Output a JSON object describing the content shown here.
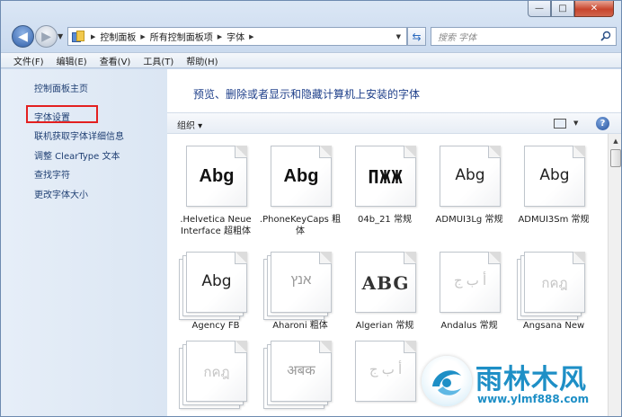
{
  "window": {
    "caption_min": "—",
    "caption_max": "□",
    "caption_close": "✕"
  },
  "address": {
    "crumbs": [
      "控制面板",
      "所有控制面板项",
      "字体"
    ],
    "search_placeholder": "搜索 字体"
  },
  "menu": [
    "文件(F)",
    "编辑(E)",
    "查看(V)",
    "工具(T)",
    "帮助(H)"
  ],
  "sidebar": {
    "items": [
      {
        "label": "控制面板主页"
      },
      {
        "label": "字体设置"
      },
      {
        "label": "联机获取字体详细信息"
      },
      {
        "label": "调整 ClearType 文本"
      },
      {
        "label": "查找字符"
      },
      {
        "label": "更改字体大小"
      }
    ]
  },
  "main": {
    "heading": "预览、删除或者显示和隐藏计算机上安装的字体",
    "organize_label": "组织 ▾",
    "help_label": "?"
  },
  "fonts": [
    {
      "sample": "Abg",
      "label": ".Helvetica Neue Interface 超粗体"
    },
    {
      "sample": "Abg",
      "label": ".PhoneKeyCaps 粗体"
    },
    {
      "sample": "ΠЖЖ",
      "label": "04b_21 常规"
    },
    {
      "sample": "Abg",
      "label": "ADMUI3Lg 常规"
    },
    {
      "sample": "Abg",
      "label": "ADMUI3Sm 常规"
    },
    {
      "sample": "Abg",
      "label": "Agency FB"
    },
    {
      "sample": "אנץ",
      "label": "Aharoni 粗体"
    },
    {
      "sample": "ABG",
      "label": "Algerian 常规"
    },
    {
      "sample": "أ ب ج",
      "label": "Andalus 常规"
    },
    {
      "sample": "กคฎ",
      "label": "Angsana New"
    },
    {
      "sample": "กคฎ",
      "label": ""
    },
    {
      "sample": "अबक",
      "label": ""
    },
    {
      "sample": "أ ب ج",
      "label": ""
    }
  ],
  "watermark": {
    "brand": "雨林木风",
    "url": "www.ylmf888.com"
  }
}
